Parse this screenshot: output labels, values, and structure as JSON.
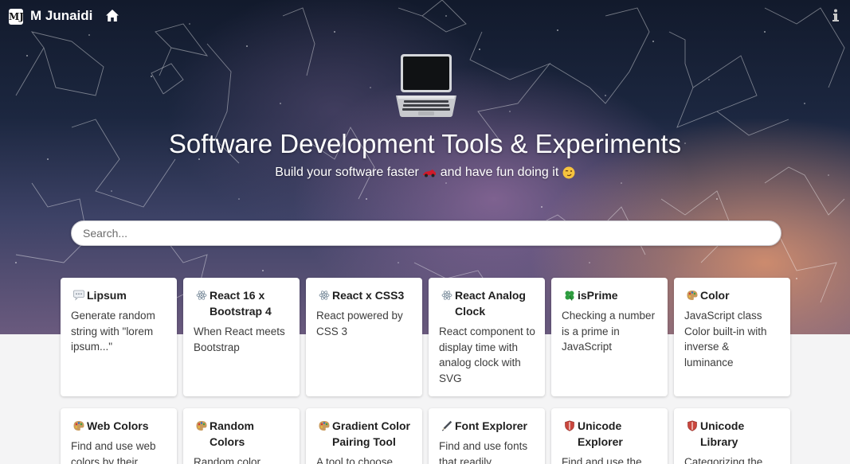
{
  "header": {
    "logo_text": "MJ",
    "brand": "M Junaidi",
    "home_icon": "home-icon",
    "info_icon": "info-icon"
  },
  "hero": {
    "emoji": "laptop",
    "title": "Software Development Tools & Experiments",
    "subtitle_part1": "Build your software faster",
    "subtitle_part2": "and have fun doing it",
    "subtitle_emoji_1": "race-car",
    "subtitle_emoji_2": "winking-face"
  },
  "search": {
    "placeholder": "Search...",
    "value": ""
  },
  "cards": [
    {
      "icon": "speech-bubble-icon",
      "title": "Lipsum",
      "desc": "Generate random string with \"lorem ipsum...\""
    },
    {
      "icon": "react-atom-icon",
      "title": "React 16 x Bootstrap 4",
      "desc": "When React meets Bootstrap"
    },
    {
      "icon": "react-atom-icon",
      "title": "React x CSS3",
      "desc": "React powered by CSS 3"
    },
    {
      "icon": "react-atom-icon",
      "title": "React Analog Clock",
      "desc": "React component to display time with analog clock with SVG"
    },
    {
      "icon": "four-leaf-clover-icon",
      "title": "isPrime",
      "desc": "Checking a number is a prime in JavaScript"
    },
    {
      "icon": "palette-icon",
      "title": "Color",
      "desc": "JavaScript class Color built-in with inverse & luminance"
    },
    {
      "icon": "palette-icon",
      "title": "Web Colors",
      "desc": "Find and use web colors by their"
    },
    {
      "icon": "palette-icon",
      "title": "Random Colors",
      "desc": "Random color schemes"
    },
    {
      "icon": "palette-icon",
      "title": "Gradient Color Pairing Tool",
      "desc": "A tool to choose"
    },
    {
      "icon": "pen-icon",
      "title": "Font Explorer",
      "desc": "Find and use fonts that readily"
    },
    {
      "icon": "shield-icon",
      "title": "Unicode Explorer",
      "desc": "Find and use the"
    },
    {
      "icon": "shield-icon",
      "title": "Unicode Library",
      "desc": "Categorizing the"
    }
  ]
}
